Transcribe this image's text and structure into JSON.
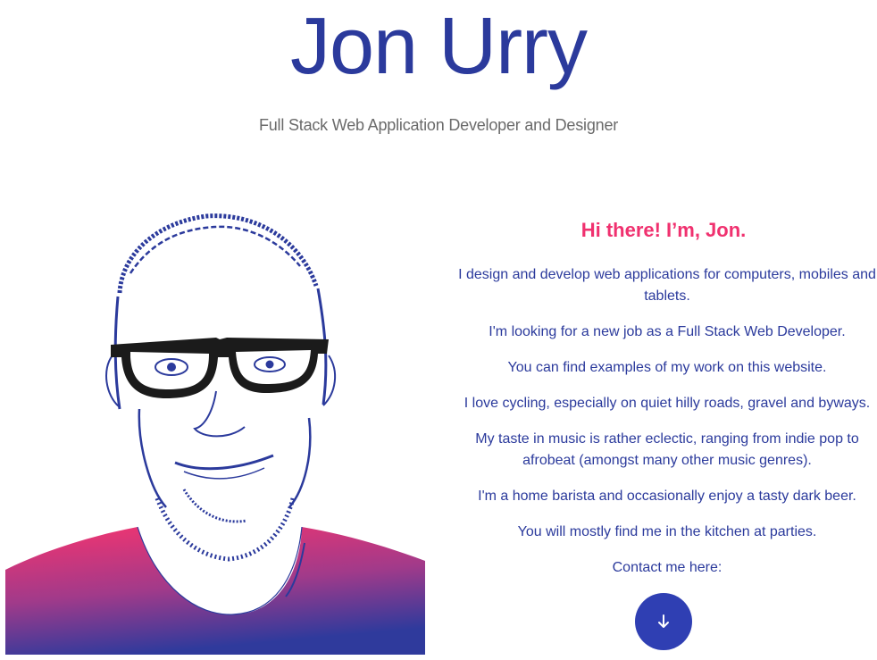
{
  "header": {
    "title": "Jon Urry",
    "subtitle": "Full Stack Web Application Developer and Designer"
  },
  "about": {
    "greeting": "Hi there! I’m, Jon.",
    "paragraphs": [
      "I design and develop web applications for computers, mobiles and tablets.",
      "I'm looking for a new job as a Full Stack Web Developer.",
      "You can find examples of my work on this website.",
      "I love cycling, especially on quiet hilly roads, gravel and byways.",
      "My taste in music is rather eclectic, ranging from indie pop to afrobeat (amongst many other music genres).",
      "I'm a home barista and occasionally enjoy a tasty dark beer.",
      "You will mostly find me in the kitchen at parties.",
      "Contact me here:"
    ]
  },
  "scroll_button": {
    "icon": "arrow-down-icon"
  },
  "colors": {
    "brand_blue": "#2b3a9c",
    "accent_pink": "#f0316f",
    "button_blue": "#2f3fb3",
    "subtitle_gray": "#6a6a6a"
  }
}
